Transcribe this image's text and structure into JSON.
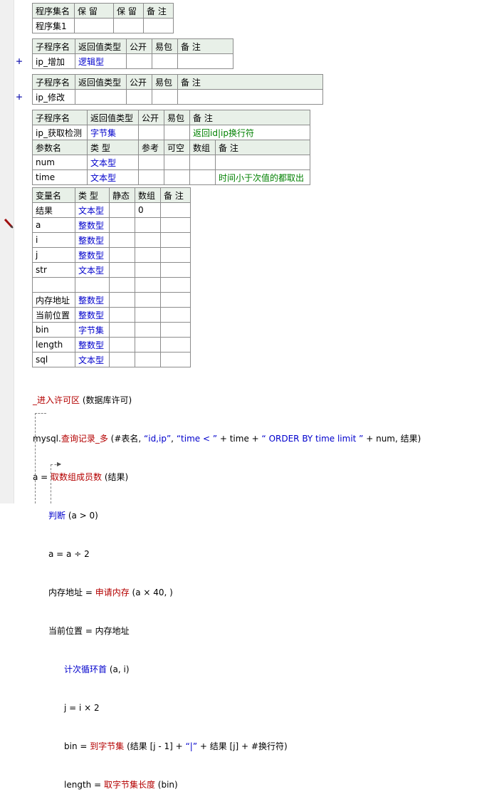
{
  "assembly_table": {
    "headers": [
      "程序集名",
      "保 留",
      "保 留",
      "备 注"
    ],
    "row": [
      "程序集1",
      "",
      "",
      ""
    ]
  },
  "sub1": {
    "headers": [
      "子程序名",
      "返回值类型",
      "公开",
      "易包",
      "备 注"
    ],
    "row": [
      "ip_增加",
      "逻辑型",
      "",
      "",
      ""
    ]
  },
  "sub2": {
    "headers": [
      "子程序名",
      "返回值类型",
      "公开",
      "易包",
      "备 注"
    ],
    "row": [
      "ip_修改",
      "",
      "",
      "",
      ""
    ]
  },
  "sub3": {
    "headers": [
      "子程序名",
      "返回值类型",
      "公开",
      "易包",
      "备 注"
    ],
    "row": [
      "ip_获取检测",
      "字节集",
      "",
      "",
      "返回id|ip换行符"
    ],
    "param_headers": [
      "参数名",
      "类 型",
      "参考",
      "可空",
      "数组",
      "备 注"
    ],
    "params": [
      [
        "num",
        "文本型",
        "",
        "",
        "",
        ""
      ],
      [
        "time",
        "文本型",
        "",
        "",
        "",
        "时间小于次值的都取出"
      ]
    ]
  },
  "vars": {
    "headers": [
      "变量名",
      "类 型",
      "静态",
      "数组",
      "备 注"
    ],
    "rows": [
      [
        "结果",
        "文本型",
        "",
        "0",
        ""
      ],
      [
        "a",
        "整数型",
        "",
        "",
        ""
      ],
      [
        "i",
        "整数型",
        "",
        "",
        ""
      ],
      [
        "j",
        "整数型",
        "",
        "",
        ""
      ],
      [
        "str",
        "文本型",
        "",
        "",
        ""
      ],
      [
        "",
        "",
        "",
        "",
        ""
      ],
      [
        "内存地址",
        "整数型",
        "",
        "",
        ""
      ],
      [
        "当前位置",
        "整数型",
        "",
        "",
        ""
      ],
      [
        "bin",
        "字节集",
        "",
        "",
        ""
      ],
      [
        "length",
        "整数型",
        "",
        "",
        ""
      ],
      [
        "sql",
        "文本型",
        "",
        "",
        ""
      ]
    ]
  },
  "code": {
    "l1_cmd": "_进入许可区",
    "l1_rest": " (数据库许可)",
    "l2_a": "mysql.",
    "l2_cmd": "查询记录_多",
    "l2_b": " (#表名, ",
    "l2_s1": "“id,ip”",
    "l2_c": ", ",
    "l2_s2": "“time < ”",
    "l2_d": " + time + ",
    "l2_s3": "“ ORDER BY time limit ”",
    "l2_e": " + num, 结果)",
    "l3_a": "a = ",
    "l3_cmd": "取数组成员数",
    "l3_b": " (结果)",
    "l4_cmd": "判断",
    "l4_b": " (a > 0)",
    "l5": "a = a ÷ 2",
    "l6_a": "内存地址 = ",
    "l6_cmd": "申请内存",
    "l6_b": " (a × 40, )",
    "l7": "当前位置 = 内存地址",
    "l8_cmd": "计次循环首",
    "l8_b": " (a, i)",
    "l9": "j = i × 2",
    "l10_a": "bin = ",
    "l10_cmd": "到字节集",
    "l10_b": " (结果 [j - 1] + ",
    "l10_s": "“|”",
    "l10_c": " + 结果 [j] + #换行符)",
    "l11_a": "length = ",
    "l11_cmd": "取字节集长度",
    "l11_b": " (bin)"
  },
  "gutter": {
    "expand_symbol": "+"
  }
}
